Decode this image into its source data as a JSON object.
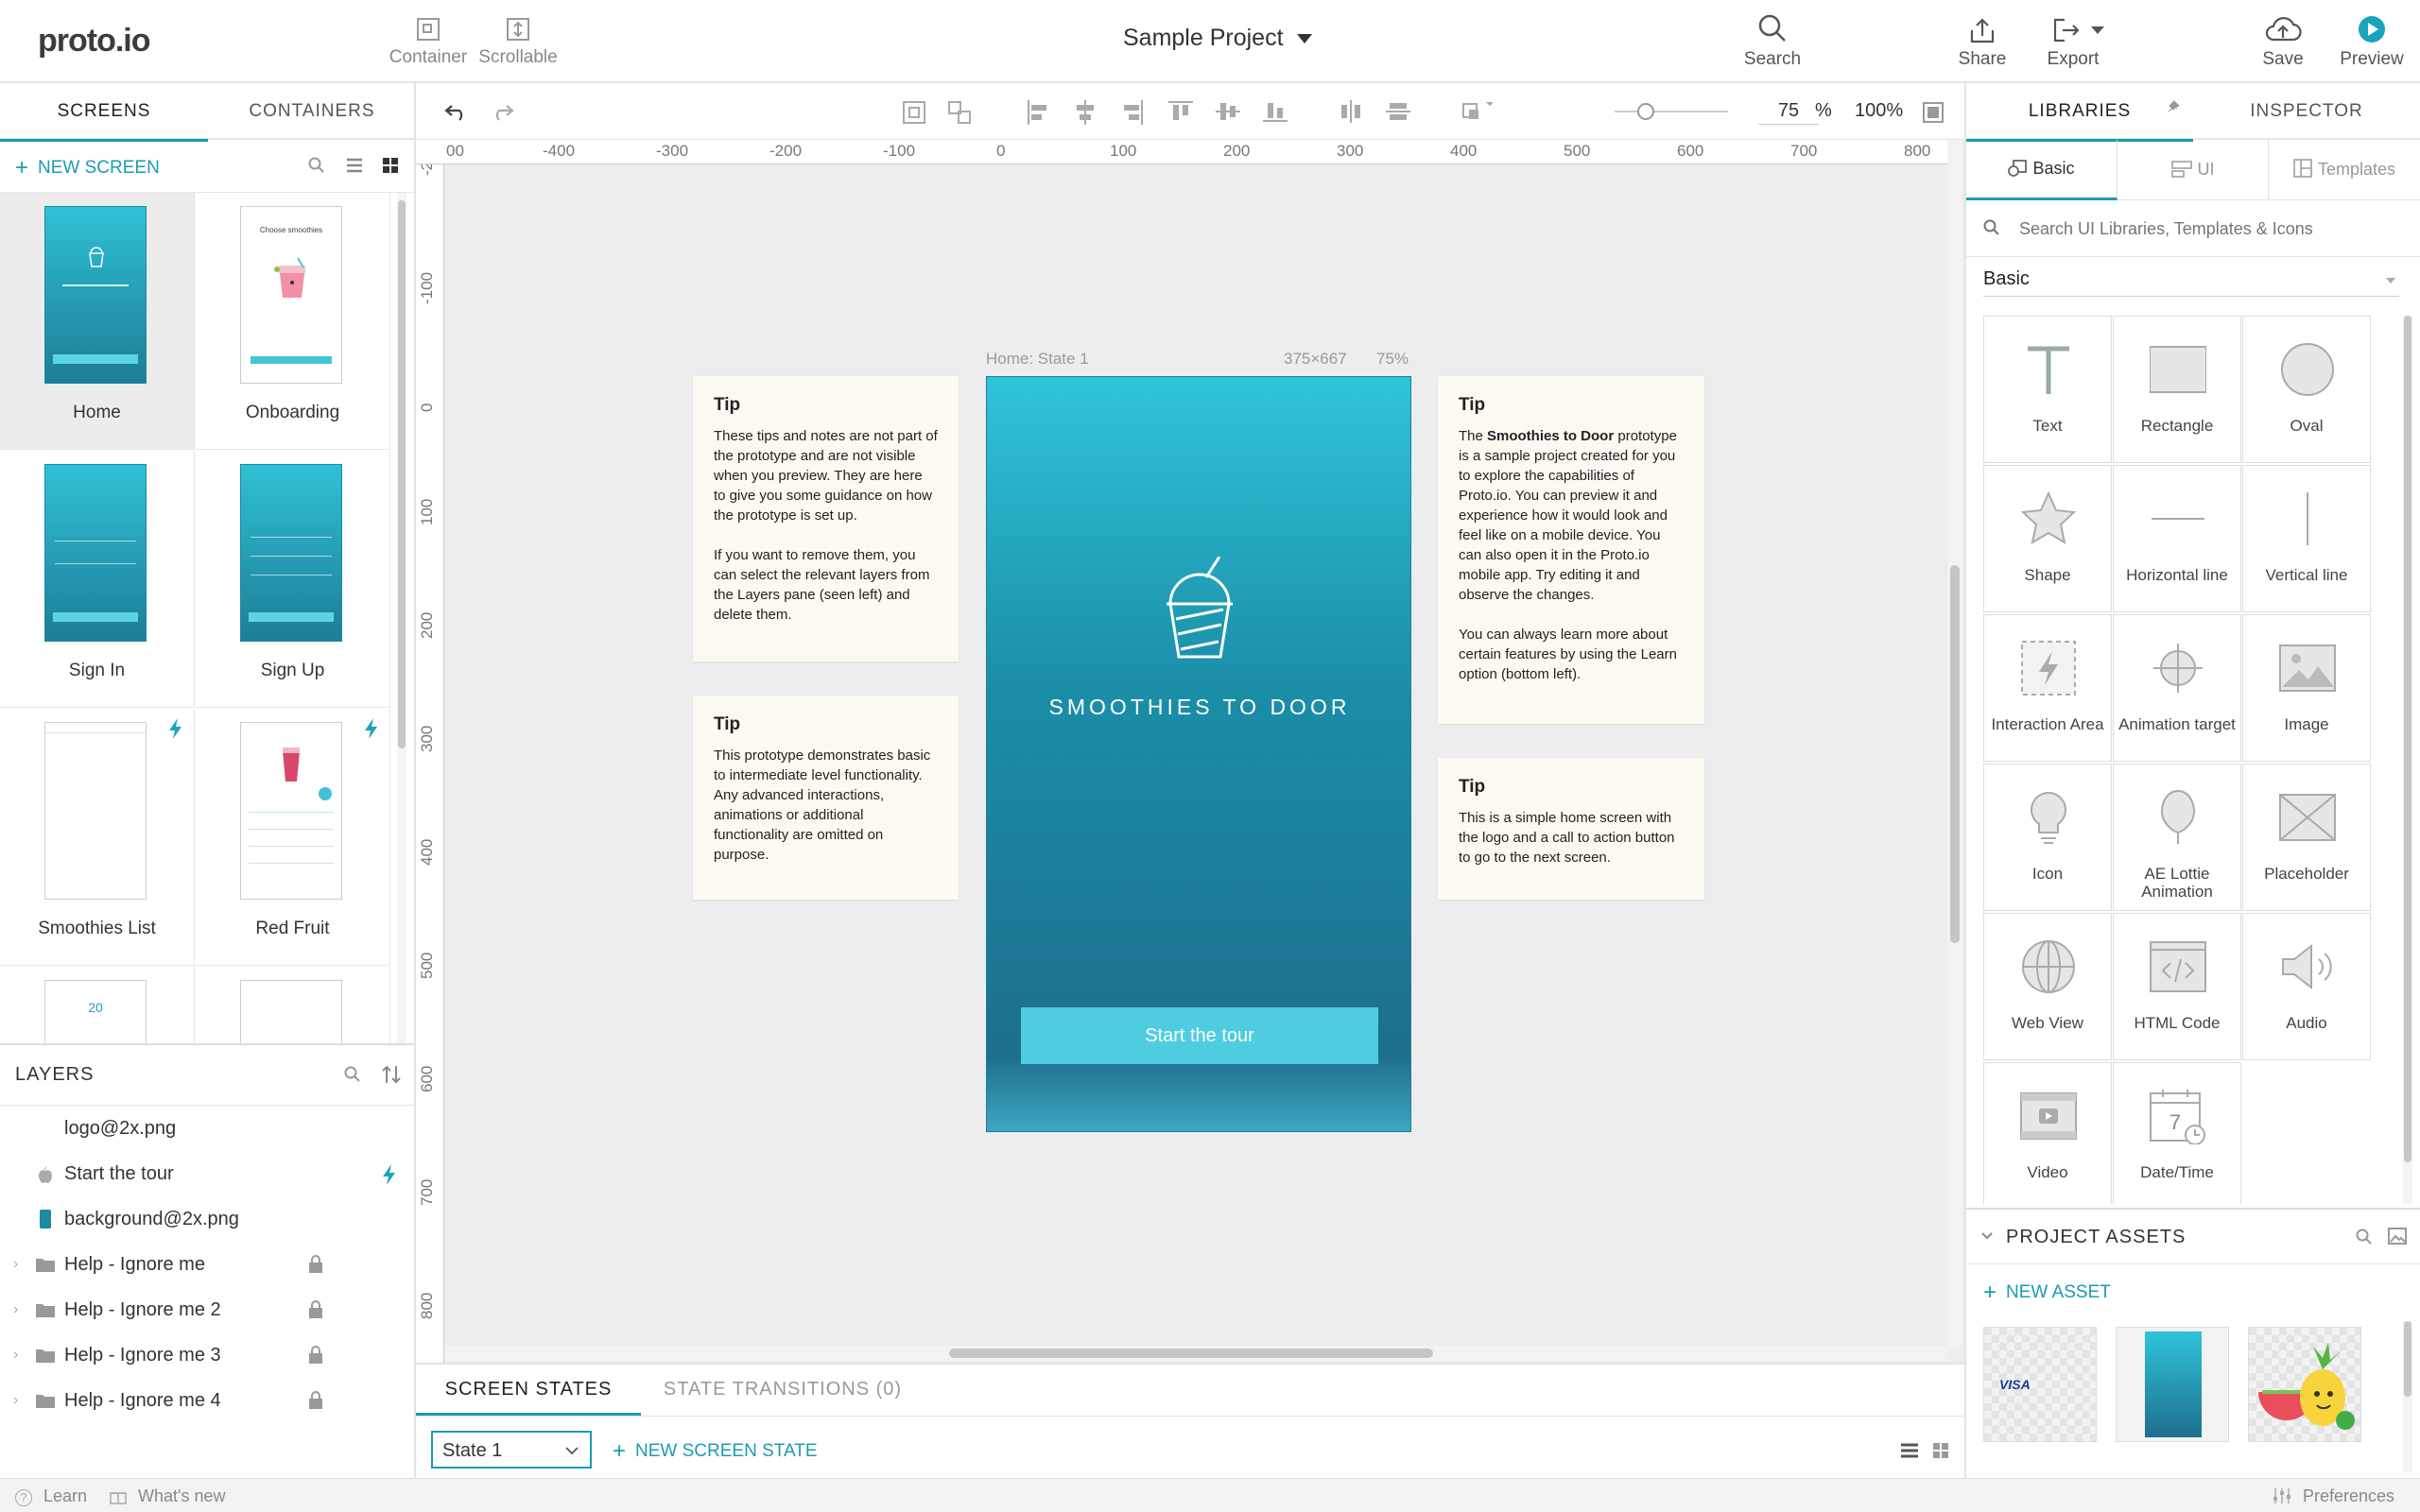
{
  "app": {
    "logo": "proto.io",
    "project_title": "Sample Project"
  },
  "toolbar": {
    "container": "Container",
    "scrollable": "Scrollable",
    "search": "Search",
    "share": "Share",
    "export": "Export",
    "save": "Save",
    "preview": "Preview"
  },
  "left_panel": {
    "tabs": [
      "SCREENS",
      "CONTAINERS"
    ],
    "new_screen": "NEW SCREEN",
    "screens": [
      {
        "label": "Home",
        "style": "teal"
      },
      {
        "label": "Onboarding",
        "style": "light"
      },
      {
        "label": "Sign In",
        "style": "teal"
      },
      {
        "label": "Sign Up",
        "style": "teal"
      },
      {
        "label": "Smoothies List",
        "style": "light"
      },
      {
        "label": "Red Fruit",
        "style": "light"
      }
    ],
    "onboarding_thumb_title": "Choose smoothies",
    "partial_thumb_number": "20",
    "layers_title": "LAYERS",
    "layers": [
      {
        "label": "logo@2x.png"
      },
      {
        "label": "Start the tour"
      },
      {
        "label": "background@2x.png"
      },
      {
        "label": "Help - Ignore me"
      },
      {
        "label": "Help - Ignore me 2"
      },
      {
        "label": "Help - Ignore me 3"
      },
      {
        "label": "Help - Ignore me 4"
      }
    ]
  },
  "canvas_toolbar": {
    "zoom_value": "75",
    "zoom_unit": "%",
    "zoom_fit": "100%"
  },
  "ruler": {
    "h": [
      "00",
      "-400",
      "-300",
      "-200",
      "-100",
      "0",
      "100",
      "200",
      "300",
      "400",
      "500",
      "600",
      "700",
      "800"
    ],
    "v": [
      "-20",
      "-100",
      "0",
      "100",
      "200",
      "300",
      "400",
      "500",
      "600",
      "700",
      "800"
    ]
  },
  "canvas": {
    "frame_label": "Home: State 1",
    "frame_size": "375×667",
    "frame_zoom": "75%",
    "brand_text": "SMOOTHIES TO DOOR",
    "cta_label": "Start the tour",
    "tips": [
      {
        "title": "Tip",
        "paragraphs": [
          "These tips and notes are not part of the prototype and are not visible when you preview. They are here to give you some guidance on how the prototype is set up.",
          "If you want to remove them, you can select the relevant layers from the Layers pane (seen left) and delete them."
        ]
      },
      {
        "title": "Tip",
        "paragraphs": [
          "This prototype demonstrates basic to intermediate level functionality. Any advanced interactions, animations or additional functionality are omitted on purpose."
        ]
      },
      {
        "title": "Tip",
        "p1_before": "The ",
        "p1_bold": "Smoothies to Door",
        "p1_after": " prototype is a sample project created for you to explore the capabilities of Proto.io. You can preview it and experience how it would look and feel like on a mobile device. You can also open it in the Proto.io mobile app. Try editing it and observe the changes.",
        "p2": "You can always learn more about certain features by using the Learn option (bottom left)."
      },
      {
        "title": "Tip",
        "paragraphs": [
          "This is a simple home screen with the logo and a call to action button to go to the next screen."
        ]
      }
    ]
  },
  "bottom": {
    "tabs": [
      "SCREEN STATES",
      "STATE TRANSITIONS (0)"
    ],
    "state_select": "State 1",
    "new_state": "NEW SCREEN STATE"
  },
  "right_panel": {
    "tabs": [
      "LIBRARIES",
      "INSPECTOR"
    ],
    "subtabs": [
      "Basic",
      "UI",
      "Templates"
    ],
    "search_placeholder": "Search UI Libraries, Templates & Icons",
    "category": "Basic",
    "items": [
      {
        "label": "Text",
        "icon": "text-icon"
      },
      {
        "label": "Rectangle",
        "icon": "rectangle-icon"
      },
      {
        "label": "Oval",
        "icon": "oval-icon"
      },
      {
        "label": "Shape",
        "icon": "star-icon"
      },
      {
        "label": "Horizontal line",
        "icon": "horizontal-line-icon"
      },
      {
        "label": "Vertical line",
        "icon": "vertical-line-icon"
      },
      {
        "label": "Interaction Area",
        "icon": "lightning-icon"
      },
      {
        "label": "Animation target",
        "icon": "crosshair-icon"
      },
      {
        "label": "Image",
        "icon": "image-icon"
      },
      {
        "label": "Icon",
        "icon": "lightbulb-icon"
      },
      {
        "label": "AE Lottie Animation",
        "icon": "balloon-icon"
      },
      {
        "label": "Placeholder",
        "icon": "placeholder-icon"
      },
      {
        "label": "Web View",
        "icon": "globe-icon"
      },
      {
        "label": "HTML Code",
        "icon": "code-icon"
      },
      {
        "label": "Audio",
        "icon": "speaker-icon"
      },
      {
        "label": "Video",
        "icon": "video-icon"
      },
      {
        "label": "Date/Time",
        "icon": "calendar-icon"
      }
    ],
    "calendar_day": "7",
    "assets_title": "PROJECT ASSETS",
    "new_asset": "NEW ASSET",
    "visa_label": "VISA"
  },
  "status_bar": {
    "learn": "Learn",
    "whats_new": "What's new",
    "preferences": "Preferences"
  },
  "colors": {
    "accent": "#1a9bb3",
    "frame_top": "#2fc4da",
    "frame_bottom": "#1f6f8c",
    "button": "#4fcde0",
    "tip_bg": "#fcf9f1"
  }
}
